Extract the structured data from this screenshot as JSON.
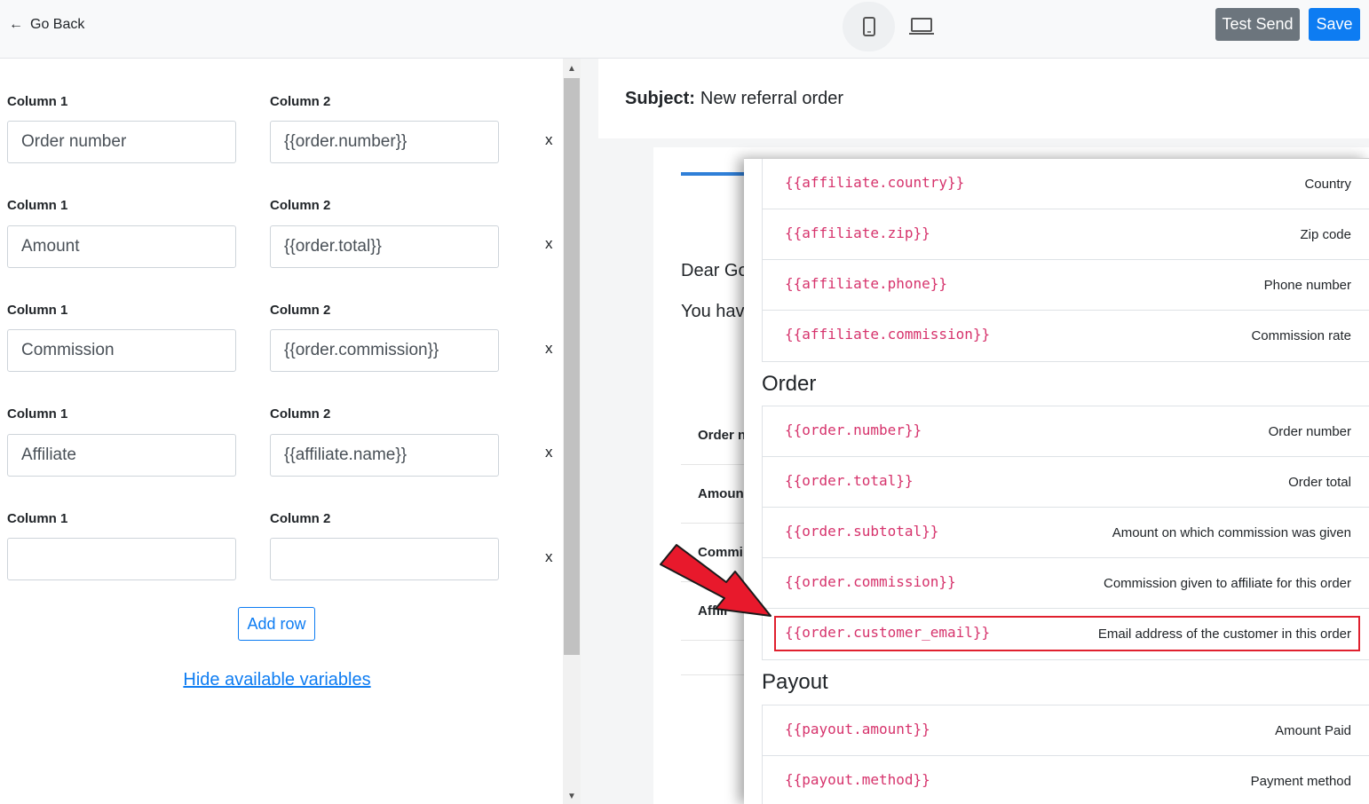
{
  "topbar": {
    "go_back_label": "Go Back",
    "device_mobile_icon": "mobile-phone-icon",
    "device_desktop_icon": "laptop-icon",
    "test_send_label": "Test Send",
    "save_label": "Save",
    "colors": {
      "secondary": "#6c757d",
      "primary": "#0d7cf2"
    }
  },
  "editor": {
    "rows": [
      {
        "col1_label": "Column 1",
        "col2_label": "Column 2",
        "col1_value": "Order number",
        "col2_value": "{{order.number}}",
        "remove": "x"
      },
      {
        "col1_label": "Column 1",
        "col2_label": "Column 2",
        "col1_value": "Amount",
        "col2_value": "{{order.total}}",
        "remove": "x"
      },
      {
        "col1_label": "Column 1",
        "col2_label": "Column 2",
        "col1_value": "Commission",
        "col2_value": "{{order.commission}}",
        "remove": "x"
      },
      {
        "col1_label": "Column 1",
        "col2_label": "Column 2",
        "col1_value": "Affiliate",
        "col2_value": "{{affiliate.name}}",
        "remove": "x"
      },
      {
        "col1_label": "Column 1",
        "col2_label": "Column 2",
        "col1_value": "",
        "col2_value": "",
        "remove": "x"
      }
    ],
    "add_row_label": "Add row",
    "hide_variables_label": "Hide available variables"
  },
  "preview": {
    "subject_label": "Subject:",
    "subject_value": "New referral order",
    "greeting": "Dear Go",
    "intro": "You hav",
    "table_rows": [
      "Order n",
      "Amoun",
      "Commi",
      "Affili"
    ]
  },
  "variables": {
    "affiliate_items": [
      {
        "code": "{{affiliate.country}}",
        "desc": "Country"
      },
      {
        "code": "{{affiliate.zip}}",
        "desc": "Zip code"
      },
      {
        "code": "{{affiliate.phone}}",
        "desc": "Phone number"
      },
      {
        "code": "{{affiliate.commission}}",
        "desc": "Commission rate"
      }
    ],
    "order_title": "Order",
    "order_items": [
      {
        "code": "{{order.number}}",
        "desc": "Order number"
      },
      {
        "code": "{{order.total}}",
        "desc": "Order total"
      },
      {
        "code": "{{order.subtotal}}",
        "desc": "Amount on which commission was given"
      },
      {
        "code": "{{order.commission}}",
        "desc": "Commission given to affiliate for this order"
      },
      {
        "code": "{{order.customer_email}}",
        "desc": "Email address of the customer in this order"
      }
    ],
    "payout_title": "Payout",
    "payout_items": [
      {
        "code": "{{payout.amount}}",
        "desc": "Amount Paid"
      },
      {
        "code": "{{payout.method}}",
        "desc": "Payment method"
      }
    ],
    "highlight_color": "#e0202e",
    "code_color": "#d6336c"
  },
  "annotation": {
    "arrow_color": "#e8192c",
    "arrow_icon": "red-arrow-icon"
  }
}
